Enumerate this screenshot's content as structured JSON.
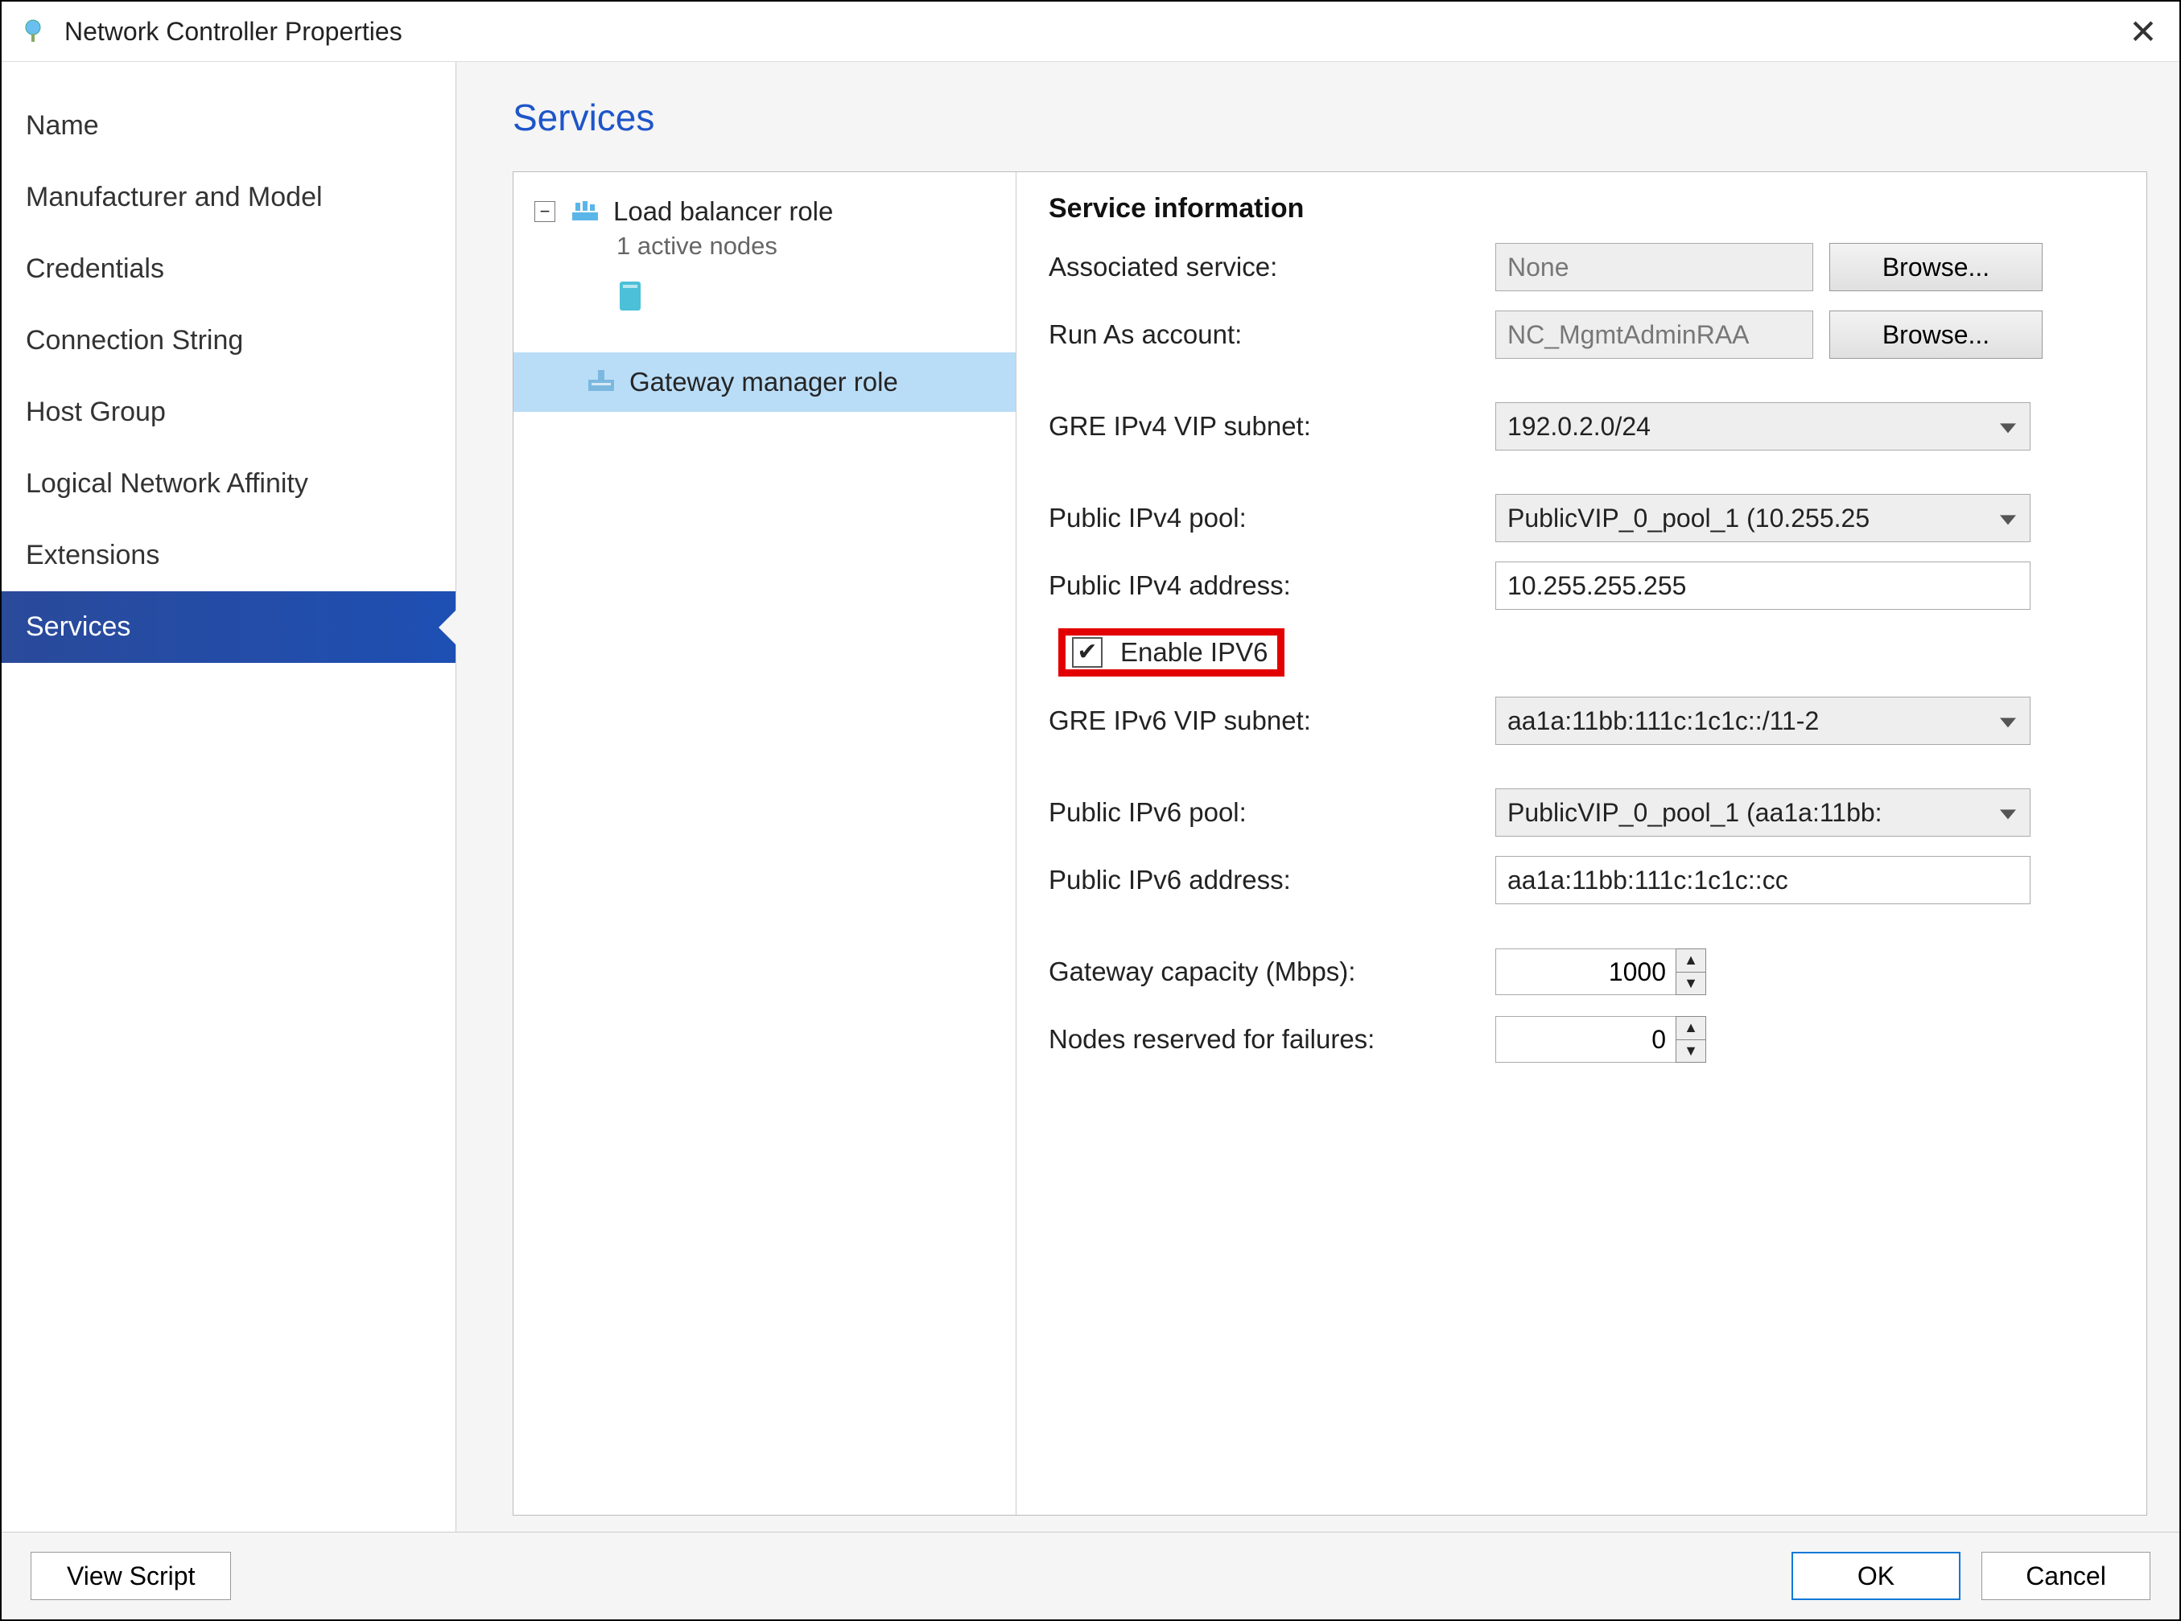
{
  "window": {
    "title": "Network Controller Properties"
  },
  "sidebar": {
    "items": [
      {
        "label": "Name"
      },
      {
        "label": "Manufacturer and Model"
      },
      {
        "label": "Credentials"
      },
      {
        "label": "Connection String"
      },
      {
        "label": "Host Group"
      },
      {
        "label": "Logical Network Affinity"
      },
      {
        "label": "Extensions"
      },
      {
        "label": "Services"
      }
    ],
    "selected": 7
  },
  "page": {
    "title": "Services"
  },
  "tree": {
    "items": [
      {
        "label": "Load balancer role",
        "sub": "1 active nodes",
        "expanded": true
      },
      {
        "label": "Gateway manager role",
        "selected": true
      }
    ]
  },
  "form": {
    "section_title": "Service information",
    "associated_service_label": "Associated service:",
    "associated_service_value": "None",
    "run_as_label": "Run As account:",
    "run_as_value": "NC_MgmtAdminRAA",
    "browse_label": "Browse...",
    "gre_v4_label": "GRE IPv4 VIP subnet:",
    "gre_v4_value": "192.0.2.0/24",
    "pub_v4_pool_label": "Public IPv4 pool:",
    "pub_v4_pool_value": "PublicVIP_0_pool_1 (10.255.25",
    "pub_v4_addr_label": "Public IPv4 address:",
    "pub_v4_addr_value": "10.255.255.255",
    "enable_ipv6_label": "Enable IPV6",
    "enable_ipv6_checked": true,
    "gre_v6_label": "GRE IPv6 VIP subnet:",
    "gre_v6_value": "aa1a:11bb:111c:1c1c::/11-2",
    "pub_v6_pool_label": "Public IPv6 pool:",
    "pub_v6_pool_value": "PublicVIP_0_pool_1 (aa1a:11bb:",
    "pub_v6_addr_label": "Public IPv6 address:",
    "pub_v6_addr_value": "aa1a:11bb:111c:1c1c::cc",
    "gw_cap_label": "Gateway capacity (Mbps):",
    "gw_cap_value": "1000",
    "nodes_label": "Nodes reserved for failures:",
    "nodes_value": "0"
  },
  "footer": {
    "view_script": "View Script",
    "ok": "OK",
    "cancel": "Cancel"
  }
}
